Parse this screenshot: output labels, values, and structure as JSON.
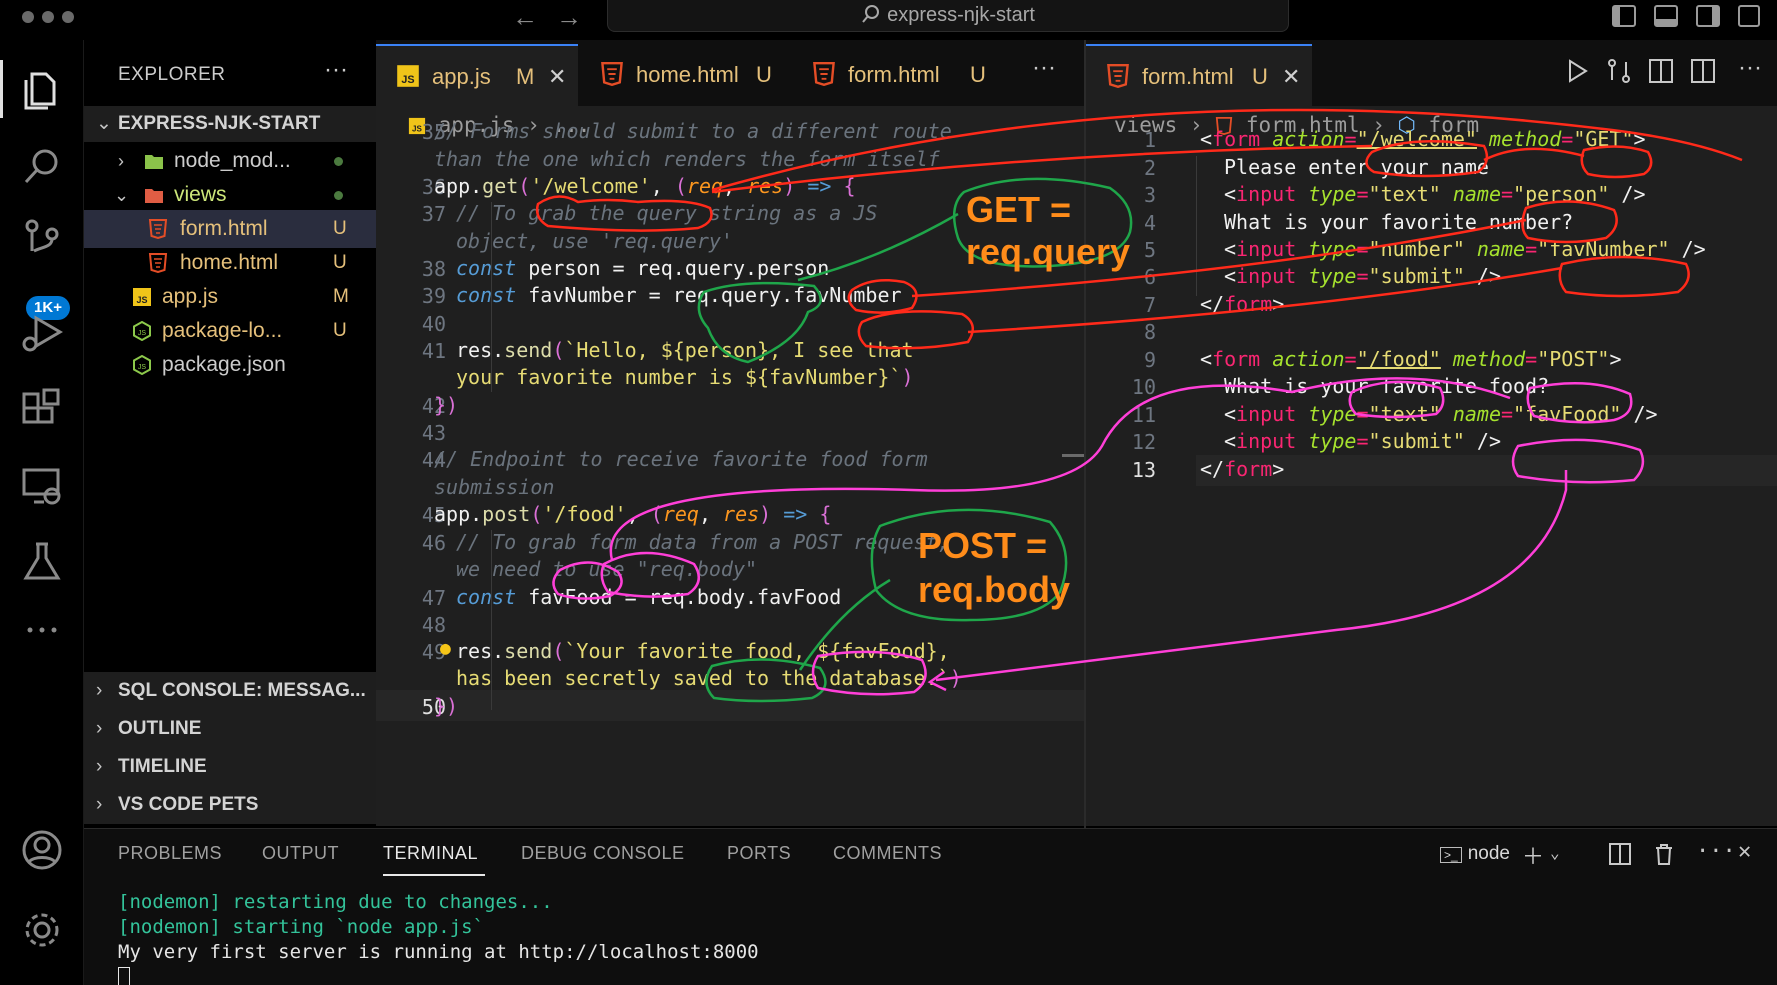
{
  "window": {
    "search_label": "express-njk-start"
  },
  "activity": {
    "badge": "1K+"
  },
  "sidebar": {
    "title": "EXPLORER",
    "more": "···",
    "project": "EXPRESS-NJK-START",
    "tree": [
      {
        "label": "node_mod...",
        "kind": "folder",
        "status": "dot"
      },
      {
        "label": "views",
        "kind": "folder-open",
        "status": "dot"
      },
      {
        "label": "form.html",
        "kind": "html",
        "status": "U"
      },
      {
        "label": "home.html",
        "kind": "html",
        "status": "U"
      },
      {
        "label": "app.js",
        "kind": "js",
        "status": "M"
      },
      {
        "label": "package-lo...",
        "kind": "node",
        "status": "U"
      },
      {
        "label": "package.json",
        "kind": "node",
        "status": ""
      }
    ],
    "sections": [
      "SQL CONSOLE: MESSAG...",
      "OUTLINE",
      "TIMELINE",
      "VS CODE PETS"
    ]
  },
  "tabs_left": [
    {
      "name": "app.js",
      "flag": "M",
      "active": true
    },
    {
      "name": "home.html",
      "flag": "U",
      "active": false
    },
    {
      "name": "form.html",
      "flag": "U",
      "active": false
    }
  ],
  "tabs_right": [
    {
      "name": "form.html",
      "flag": "U",
      "active": true
    }
  ],
  "breadcrumb_left": {
    "file": "app.js",
    "rest": "..."
  },
  "breadcrumb_right": {
    "folder": "views",
    "file": "form.html",
    "symbol": "form"
  },
  "left_code": {
    "line_numbers": [
      "35",
      "36",
      "37",
      "38",
      "39",
      "40",
      "41",
      "42",
      "43",
      "44",
      "45",
      "46",
      "47",
      "48",
      "49",
      "50"
    ],
    "current_line": "50"
  },
  "right_code": {
    "line_numbers": [
      "1",
      "2",
      "3",
      "4",
      "5",
      "6",
      "7",
      "8",
      "9",
      "10",
      "11",
      "12",
      "13"
    ],
    "current_line": "13"
  },
  "annotations": {
    "get_line1": "GET =",
    "get_line2": "req.query",
    "post_line1": "POST =",
    "post_line2": "req.body"
  },
  "panel": {
    "tabs": [
      "PROBLEMS",
      "OUTPUT",
      "TERMINAL",
      "DEBUG CONSOLE",
      "PORTS",
      "COMMENTS"
    ],
    "active_tab": "TERMINAL",
    "terminal_name": "node",
    "lines": [
      "[nodemon] restarting due to changes...",
      "[nodemon] starting `node app.js`",
      "My very first server is running at http://localhost:8000"
    ]
  },
  "colors": {
    "accent": "#0078d4",
    "annotation_red": "#ff2a1a",
    "annotation_green": "#1fa64a",
    "annotation_pink": "#ff3fd8",
    "annotation_orange": "#ff8c1a"
  }
}
